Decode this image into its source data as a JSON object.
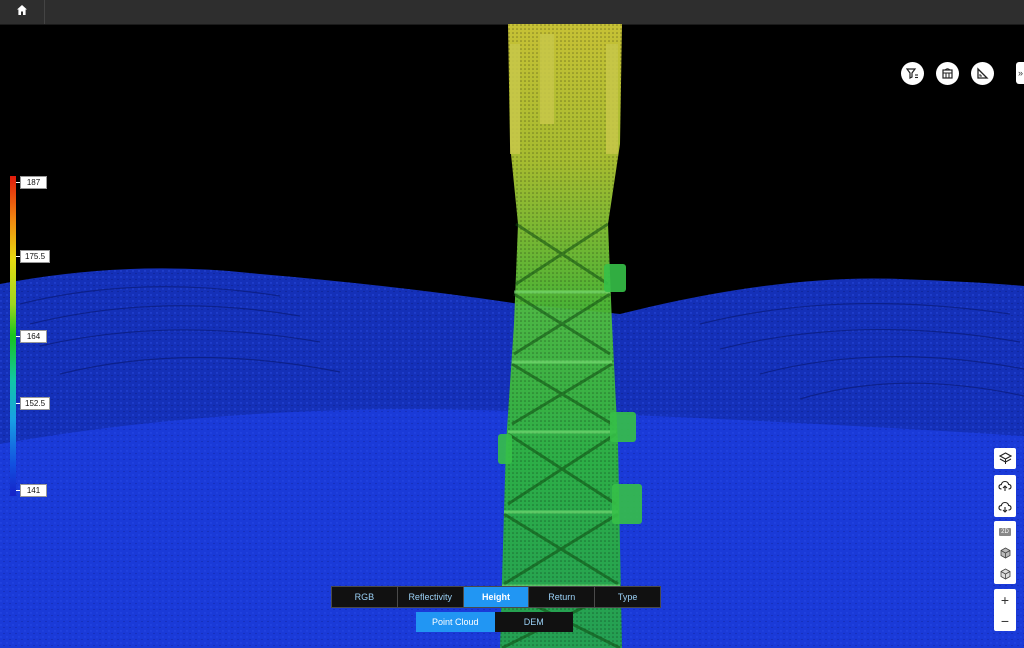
{
  "topbar": {
    "home_icon": "home-icon"
  },
  "toolbar": {
    "filter_icon": "filter-icon",
    "measure_volume_icon": "box-measure-icon",
    "measure_angle_icon": "angle-ruler-icon",
    "expand_label": "»"
  },
  "legend": {
    "ticks": [
      "187",
      "175.5",
      "164",
      "152.5",
      "141"
    ],
    "colors": [
      "#e21b0c",
      "#f08a10",
      "#e8dc10",
      "#17c41f",
      "#18a0e4",
      "#1522c8"
    ]
  },
  "modes": {
    "items": [
      "RGB",
      "Reflectivity",
      "Height",
      "Return",
      "Type"
    ],
    "active": "Height"
  },
  "sources": {
    "items": [
      "Point Cloud",
      "DEM"
    ],
    "active": "Point Cloud"
  },
  "side_controls": {
    "zoom_in": "+",
    "zoom_out": "−",
    "view_2d_label": "2D"
  }
}
